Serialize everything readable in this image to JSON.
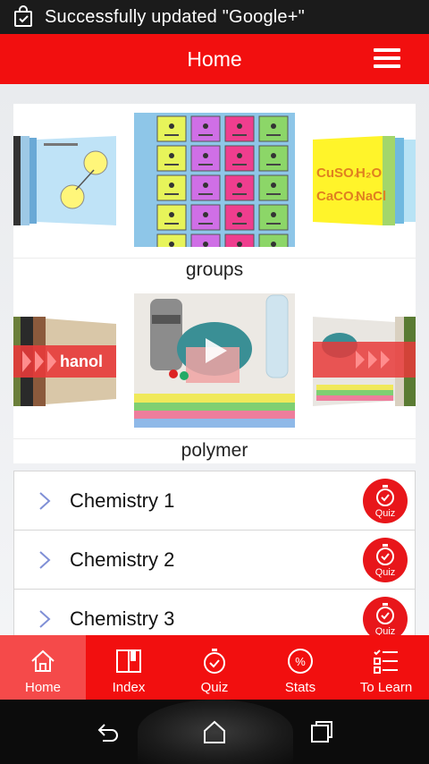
{
  "status_bar": {
    "notification": "Successfully updated \"Google+\""
  },
  "app_bar": {
    "title": "Home"
  },
  "carousels": [
    {
      "caption": "groups"
    },
    {
      "caption": "polymer"
    }
  ],
  "chapters": [
    {
      "name": "Chemistry 1",
      "quiz_label": "Quiz"
    },
    {
      "name": "Chemistry 2",
      "quiz_label": "Quiz"
    },
    {
      "name": "Chemistry 3",
      "quiz_label": "Quiz"
    }
  ],
  "bottom_nav": [
    {
      "label": "Home",
      "icon": "home-icon",
      "active": true
    },
    {
      "label": "Index",
      "icon": "book-icon"
    },
    {
      "label": "Quiz",
      "icon": "stopwatch-icon"
    },
    {
      "label": "Stats",
      "icon": "percent-icon"
    },
    {
      "label": "To Learn",
      "icon": "checklist-icon"
    }
  ],
  "thumbnail_text": {
    "formulas": "CuSO4 H2O CaCO3 NaCl",
    "bottle_word": "ethanol"
  },
  "colors": {
    "primary": "#f20f0f",
    "active_tab": "#f54a4a",
    "quiz_badge": "#e8161a"
  }
}
